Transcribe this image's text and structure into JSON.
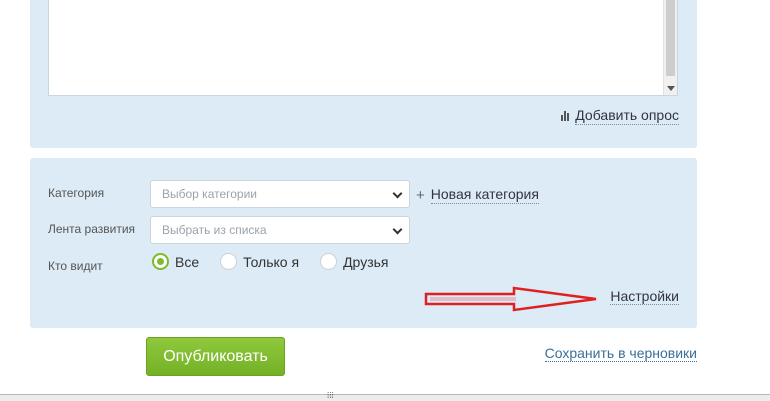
{
  "editor": {
    "add_poll_label": "Добавить опрос",
    "add_poll_icon": "bar-chart-icon"
  },
  "form": {
    "category": {
      "label": "Категория",
      "placeholder": "Выбор категории",
      "new_category_label": "Новая категория",
      "new_category_icon": "plus-icon"
    },
    "feed": {
      "label": "Лента развития",
      "placeholder": "Выбрать из списка"
    },
    "visibility": {
      "label": "Кто видит",
      "options": [
        {
          "label": "Все",
          "checked": true
        },
        {
          "label": "Только я",
          "checked": false
        },
        {
          "label": "Друзья",
          "checked": false
        }
      ]
    },
    "settings_label": "Настройки"
  },
  "actions": {
    "publish_label": "Опубликовать",
    "save_draft_label": "Сохранить в черновики"
  },
  "colors": {
    "panel_bg": "#dcebf6",
    "accent_green": "#7dbb2c",
    "link_blue": "#3a6f98",
    "annotation_red": "#e02020"
  },
  "annotation": {
    "arrow_icon": "red-arrow-icon"
  }
}
